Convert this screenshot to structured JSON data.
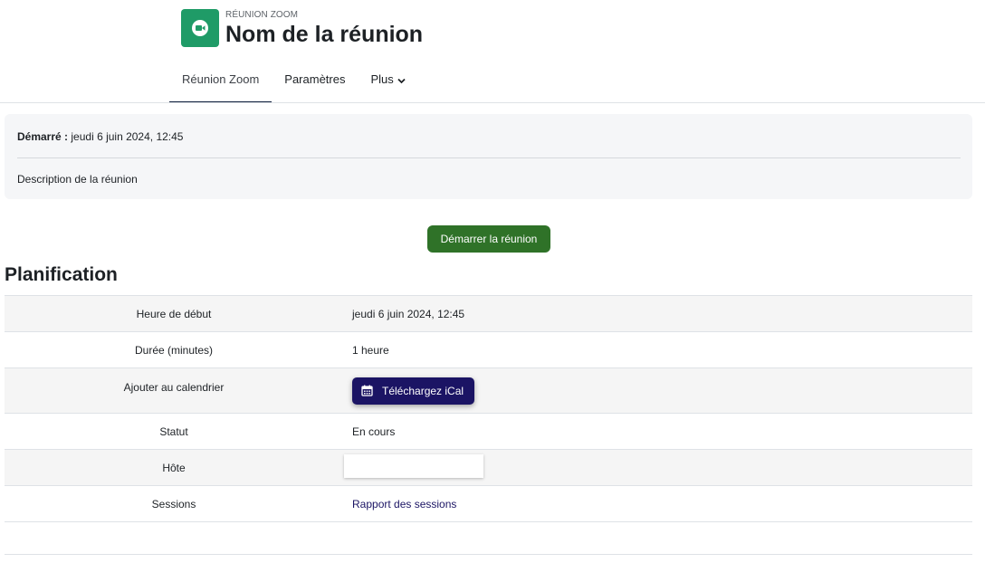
{
  "header": {
    "module_label": "RÉUNION ZOOM",
    "title": "Nom de la réunion",
    "icon": "video-camera-icon",
    "icon_color": "#1f9b67"
  },
  "tabs": [
    {
      "label": "Réunion Zoom",
      "active": true
    },
    {
      "label": "Paramètres",
      "active": false
    },
    {
      "label": "Plus",
      "active": false
    }
  ],
  "info": {
    "started_label": "Démarré :",
    "started_value": "jeudi 6 juin 2024, 12:45",
    "description": "Description de la réunion"
  },
  "start_button": {
    "label": "Démarrer la réunion",
    "color": "#2f7228"
  },
  "schedule": {
    "title": "Planification",
    "rows": {
      "start_time": {
        "label": "Heure de début",
        "value": "jeudi 6 juin 2024, 12:45"
      },
      "duration": {
        "label": "Durée (minutes)",
        "value": "1 heure"
      },
      "calendar": {
        "label": "Ajouter au calendrier",
        "button_label": "Téléchargez iCal"
      },
      "status": {
        "label": "Statut",
        "value": "En cours"
      },
      "host": {
        "label": "Hôte",
        "value": ""
      },
      "sessions": {
        "label": "Sessions",
        "link_label": "Rapport des sessions"
      }
    }
  },
  "colors": {
    "primary_dark": "#1b1464",
    "tab_underline": "#0f1f3d"
  }
}
